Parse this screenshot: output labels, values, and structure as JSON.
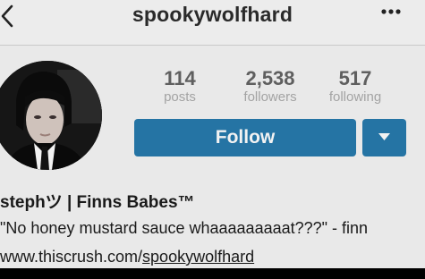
{
  "header": {
    "username": "spookywolfhard",
    "back_icon": "chevron-left-icon",
    "more_icon": "more-dots-icon"
  },
  "stats": {
    "posts": {
      "value": "114",
      "label": "posts"
    },
    "followers": {
      "value": "2,538",
      "label": "followers"
    },
    "following": {
      "value": "517",
      "label": "following"
    }
  },
  "actions": {
    "follow_label": "Follow",
    "dropdown_icon": "caret-down-icon"
  },
  "profile": {
    "display_name": "stephツ | Finns Babes™",
    "bio": "\"No honey mustard sauce whaaaaaaaaat???\" - finn",
    "link_domain": "www.thiscrush.com/",
    "link_path": "spookywolfhard"
  },
  "colors": {
    "accent": "#2574a4",
    "background": "#e9e9e9"
  }
}
